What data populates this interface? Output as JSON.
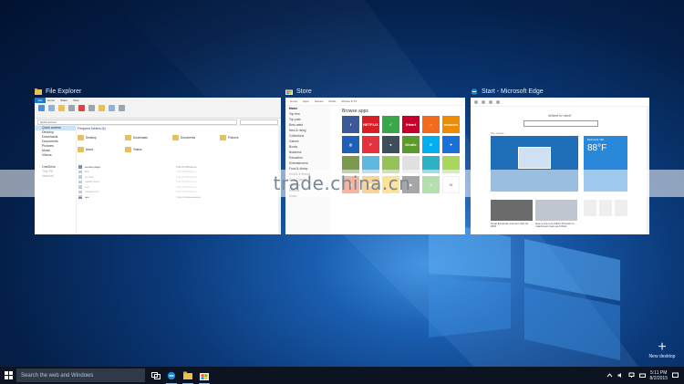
{
  "windows": {
    "explorer": {
      "title": "File Explorer",
      "ribbon_file": "File",
      "ribbon_tabs": [
        "Home",
        "Share",
        "View"
      ],
      "address": "Quick access",
      "nav_items": [
        "Quick access",
        "Desktop",
        "Downloads",
        "Documents",
        "Pictures",
        "Music",
        "Videos",
        "OneDrive",
        "This PC",
        "Network"
      ],
      "section": "Frequent folders (6)",
      "folders": [
        "Desktop",
        "Downloads",
        "Documents",
        "Pictures",
        "Music",
        "Videos"
      ],
      "recent_files": [
        {
          "name": "sunset plage",
          "path": "This PC\\Pictures"
        },
        {
          "name": "Bay",
          "path": "This PC\\Pictures"
        },
        {
          "name": "sunrise",
          "path": "This PC\\Pictures"
        },
        {
          "name": "Sailed down",
          "path": "This PC\\Pictures"
        },
        {
          "name": "surf",
          "path": "This PC\\Pictures"
        },
        {
          "name": "Instagramm",
          "path": "This PC\\Pictures"
        },
        {
          "name": "doc",
          "path": "This PC\\Documents"
        }
      ]
    },
    "store": {
      "title": "Store",
      "toolbar": [
        "Home",
        "Apps",
        "Games",
        "Music",
        "Movies & TV"
      ],
      "side_header": "Home",
      "side_items": [
        "Top free",
        "Top paid",
        "Best-rated",
        "New & rising",
        "Collections",
        "Games",
        "Books",
        "Business",
        "Education",
        "Entertainment",
        "Food & dining",
        "Health & fitness",
        "Kids & family",
        "Lifestyle",
        "Medical",
        "Music"
      ],
      "main_header": "Browse apps",
      "tiles": [
        {
          "label": "f",
          "color": "#3b5998"
        },
        {
          "label": "NETFLIX",
          "color": "#d81f26"
        },
        {
          "label": "✓",
          "color": "#3aa74a"
        },
        {
          "label": "iHeart",
          "color": "#c6002b"
        },
        {
          "label": "♫",
          "color": "#f26b1d"
        },
        {
          "label": "amazon",
          "color": "#f08a00"
        },
        {
          "label": "◎",
          "color": "#1e5fb7"
        },
        {
          "label": "F",
          "color": "#e6323e"
        },
        {
          "label": "●",
          "color": "#3f4e5b"
        },
        {
          "label": "Kindle",
          "color": "#5b9b2b"
        },
        {
          "label": "S",
          "color": "#00aff0"
        },
        {
          "label": "✦",
          "color": "#1a6fd8"
        },
        {
          "label": "",
          "color": "#7c9a4d"
        },
        {
          "label": "",
          "color": "#5fb9df"
        },
        {
          "label": "",
          "color": "#95c35a"
        },
        {
          "label": "",
          "color": "#e0e0e0"
        },
        {
          "label": "",
          "color": "#2bb2c5"
        },
        {
          "label": "",
          "color": "#a9d65c"
        },
        {
          "label": "◉",
          "color": "#e85c2b"
        },
        {
          "label": "▣",
          "color": "#f0a01a"
        },
        {
          "label": "◆",
          "color": "#f5c21b"
        },
        {
          "label": "▶",
          "color": "#3a3a3a"
        },
        {
          "label": "≈",
          "color": "#5bb84b"
        },
        {
          "label": "W",
          "color": "#ffffff"
        }
      ]
    },
    "edge": {
      "title": "Start - Microsoft Edge",
      "question": "Where to next?",
      "top_stories": "Top stories",
      "weather_loc": "Redmond, WA",
      "temp": "88°F",
      "captions": [
        "Great European summer sites for 2015",
        "How a one-in-a-million Pinnacle to mainstream Gain and Chart",
        "",
        ""
      ]
    }
  },
  "new_desktop": "New desktop",
  "taskbar": {
    "search_placeholder": "Search the web and Windows",
    "time": "5:11 PM",
    "date": "8/2/2015"
  },
  "watermark": "trade.china.cn",
  "colors": {
    "accent": "#1979ca",
    "taskbar": "#0b1420"
  }
}
